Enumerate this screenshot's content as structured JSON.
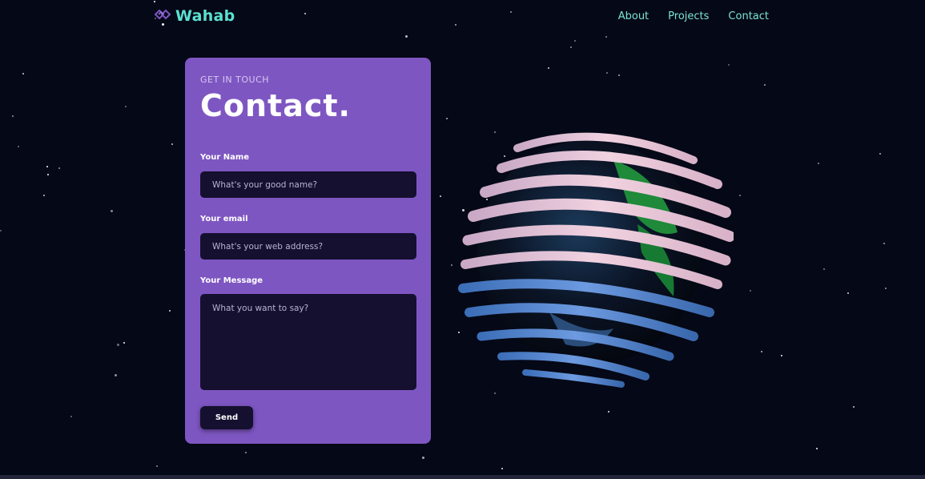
{
  "nav": {
    "logo_text": "Wahab",
    "links": [
      "About",
      "Projects",
      "Contact"
    ]
  },
  "contact_form": {
    "subtitle": "GET IN TOUCH",
    "title": "Contact.",
    "name_label": "Your Name",
    "name_placeholder": "What's your good name?",
    "email_label": "Your email",
    "email_placeholder": "What's your web address?",
    "message_label": "Your Message",
    "message_placeholder": "What you want to say?",
    "send_label": "Send"
  },
  "colors": {
    "background": "#050816",
    "card": "#7e56c2",
    "field": "#151030",
    "accent": "#5be0d2"
  },
  "icons": [
    "logo-icon",
    "earth-globe-model"
  ]
}
